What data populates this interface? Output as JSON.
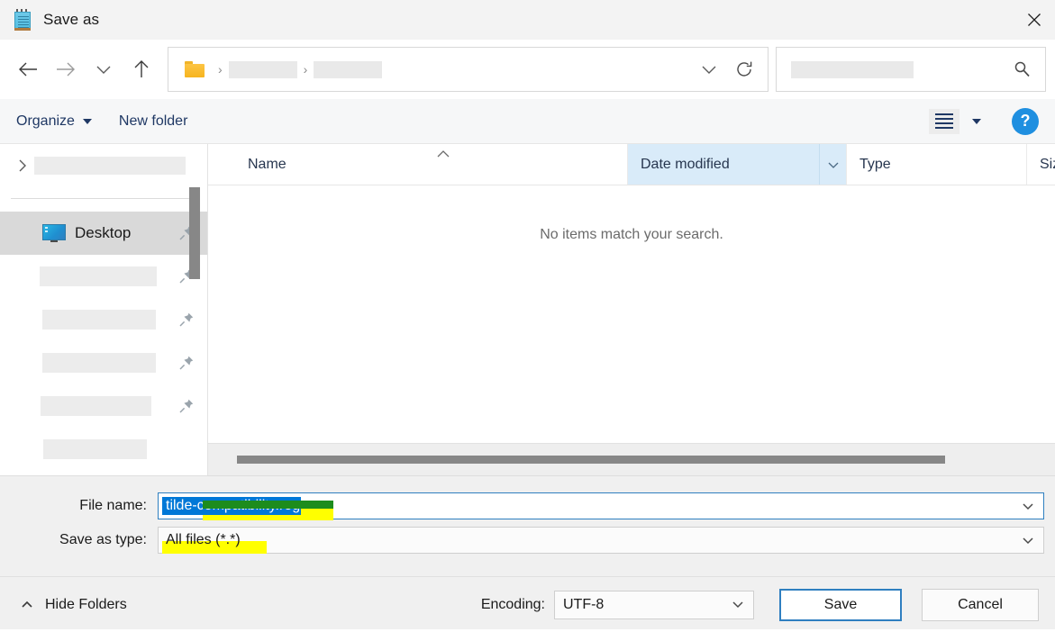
{
  "window": {
    "title": "Save as",
    "icon": "notepad-icon",
    "close_label": "×"
  },
  "nav": {
    "back_icon": "arrow-left-icon",
    "forward_icon": "arrow-right-icon",
    "recent_icon": "chevron-down-icon",
    "up_icon": "arrow-up-icon",
    "address": {
      "folder_icon": "folder-icon",
      "separator": "›",
      "crumbs": [
        {
          "label": "",
          "redacted": true,
          "width": 76
        },
        {
          "label": "",
          "redacted": true,
          "width": 76
        }
      ],
      "dropdown_icon": "chevron-down-icon",
      "refresh_icon": "refresh-icon"
    },
    "search": {
      "placeholder": "",
      "value": "",
      "redacted": true,
      "icon": "search-icon"
    }
  },
  "toolbar": {
    "organize_label": "Organize",
    "new_folder_label": "New folder",
    "view_icon": "list-view-icon",
    "view_dropdown_icon": "chevron-down-icon",
    "help_label": "?",
    "help_icon": "help-icon",
    "accent_color": "#1f3864"
  },
  "sidebar": {
    "tree_item": {
      "label": "",
      "redacted": true,
      "chevron_icon": "chevron-right-icon"
    },
    "items": [
      {
        "label": "Desktop",
        "icon": "desktop-monitor-icon",
        "selected": true,
        "pin_icon": "pin-icon",
        "redacted": false
      },
      {
        "label": "",
        "redacted": true,
        "width": 130,
        "pin_icon": "pin-icon",
        "selected": false
      },
      {
        "label": "",
        "redacted": true,
        "width": 126,
        "pin_icon": "pin-icon",
        "selected": false
      },
      {
        "label": "",
        "redacted": true,
        "width": 126,
        "pin_icon": "pin-icon",
        "selected": false
      },
      {
        "label": "",
        "redacted": true,
        "width": 123,
        "pin_icon": "pin-icon",
        "selected": false
      },
      {
        "label": "",
        "redacted": true,
        "width": 115,
        "pin_icon": "",
        "selected": false
      }
    ],
    "scrollbar": {
      "visible": true
    }
  },
  "filelist": {
    "columns": [
      {
        "key": "name",
        "label": "Name",
        "sorted": false,
        "sort_direction": "asc"
      },
      {
        "key": "date",
        "label": "Date modified",
        "sorted": true,
        "has_dropdown": true
      },
      {
        "key": "type",
        "label": "Type",
        "sorted": false
      },
      {
        "key": "size",
        "label": "Siz",
        "sorted": false
      }
    ],
    "sort_indicator_icon": "sort-ascending-icon",
    "empty_message": "No items match your search.",
    "rows": [],
    "horizontal_scrollbar": {
      "visible": true
    }
  },
  "fields": {
    "file_name": {
      "label": "File name:",
      "value": "tilde-compatibility.reg",
      "selected": true,
      "focused": true,
      "dropdown_icon": "chevron-down-icon",
      "annotation": {
        "type": "highlighter",
        "color": "#ffff00"
      }
    },
    "save_as_type": {
      "label": "Save as type:",
      "value": "All files  (*.*)",
      "dropdown_icon": "chevron-down-icon",
      "annotation": {
        "type": "highlighter",
        "color": "#ffff00"
      }
    }
  },
  "footer": {
    "hide_folders_label": "Hide Folders",
    "hide_folders_icon": "chevron-up-icon",
    "encoding_label": "Encoding:",
    "encoding_value": "UTF-8",
    "encoding_dropdown_icon": "chevron-down-icon",
    "save_label": "Save",
    "cancel_label": "Cancel",
    "primary_accent": "#2f7fc0"
  }
}
